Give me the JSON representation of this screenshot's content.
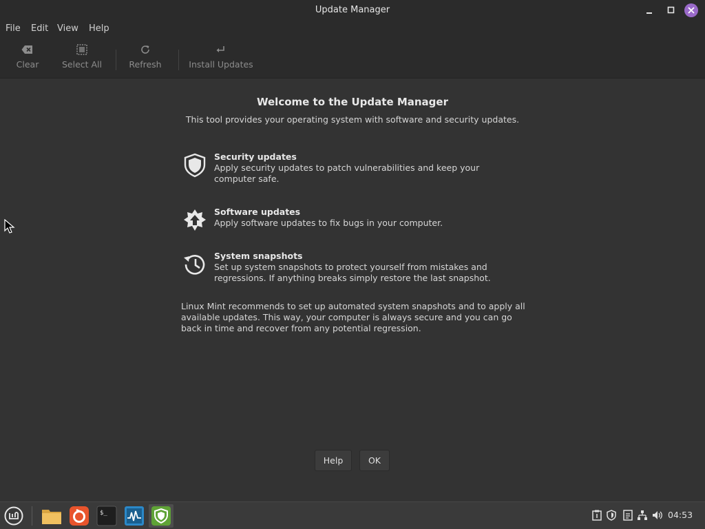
{
  "window": {
    "title": "Update Manager"
  },
  "menu": {
    "items": [
      {
        "label": "File"
      },
      {
        "label": "Edit"
      },
      {
        "label": "View"
      },
      {
        "label": "Help"
      }
    ]
  },
  "toolbar": {
    "clear_label": "Clear",
    "select_all_label": "Select All",
    "refresh_label": "Refresh",
    "install_label": "Install Updates",
    "clear_icon": "backspace-icon",
    "select_all_icon": "select-all-icon",
    "refresh_icon": "refresh-icon",
    "install_icon": "enter-arrow-icon"
  },
  "welcome": {
    "title": "Welcome to the Update Manager",
    "subtitle": "This tool provides your operating system with software and security updates.",
    "features": [
      {
        "icon": "shield-icon",
        "title": "Security updates",
        "description": "Apply security updates to patch vulnerabilities and keep your computer safe."
      },
      {
        "icon": "upload-star-icon",
        "title": "Software updates",
        "description": "Apply software updates to fix bugs in your computer."
      },
      {
        "icon": "history-icon",
        "title": "System snapshots",
        "description": "Set up system snapshots to protect yourself from mistakes and regressions. If anything breaks simply restore the last snapshot."
      }
    ],
    "recommendation": "Linux Mint recommends to set up automated system snapshots and to apply all available updates. This way, your computer is always secure and you can go back in time and recover from any potential regression."
  },
  "buttons": {
    "help_label": "Help",
    "ok_label": "OK"
  },
  "taskbar": {
    "apps": [
      {
        "name": "menu-icon"
      },
      {
        "name": "files-icon"
      },
      {
        "name": "firefox-icon"
      },
      {
        "name": "terminal-icon"
      },
      {
        "name": "system-monitor-icon"
      },
      {
        "name": "update-manager-icon"
      }
    ],
    "tray": [
      "clipboard-icon",
      "update-shield-icon",
      "notes-icon",
      "network-icon",
      "volume-icon"
    ],
    "clock": "04:53"
  },
  "colors": {
    "accent_close": "#9a6ac9",
    "mint_green": "#5fa336"
  }
}
